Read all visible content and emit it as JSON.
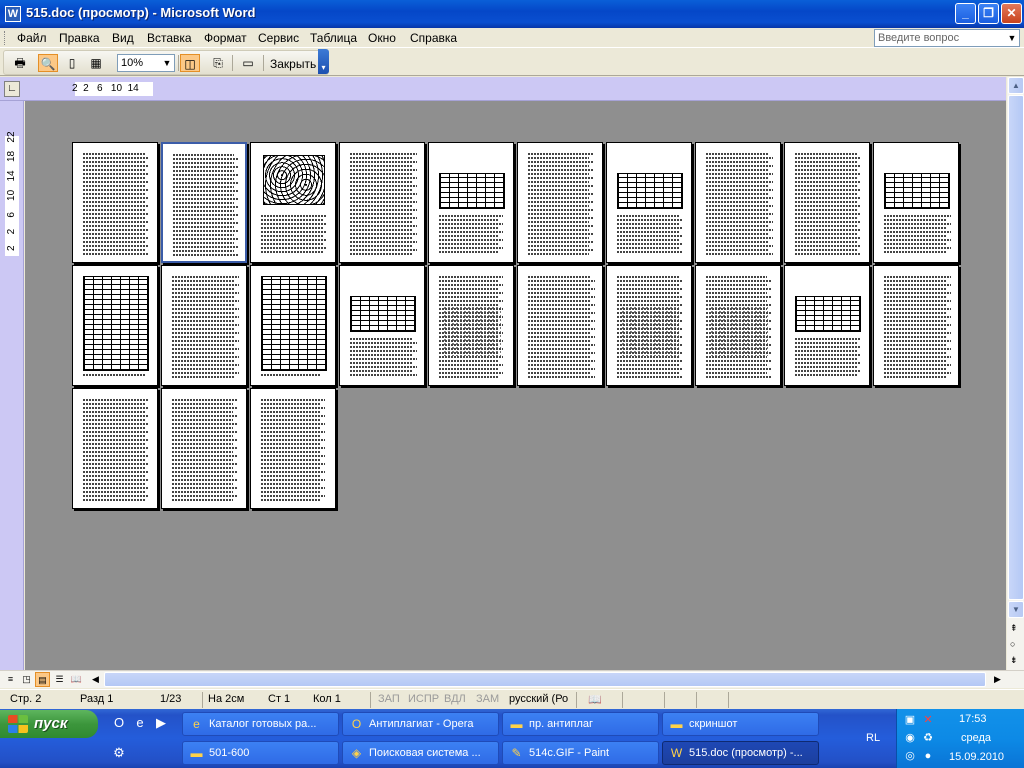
{
  "window": {
    "title": "515.doc (просмотр) - Microsoft Word",
    "icon": "word-doc-icon"
  },
  "menu": {
    "items": [
      "Файл",
      "Правка",
      "Вид",
      "Вставка",
      "Формат",
      "Сервис",
      "Таблица",
      "Окно",
      "Справка"
    ],
    "ask_placeholder": "Введите вопрос"
  },
  "toolbar": {
    "zoom": "10%",
    "close_label": "Закрыть"
  },
  "ruler": {
    "horizontal_marks": "2  2   6   10  14",
    "vertical_marks": "2    2    6    10   14   18   22"
  },
  "preview": {
    "page_count": 23,
    "selected_page": 2
  },
  "statusbar": {
    "page": "Стр. 2",
    "section": "Разд 1",
    "pages": "1/23",
    "at": "На  2см",
    "line": "Ст  1",
    "column": "Кол  1",
    "rec": "ЗАП",
    "trk": "ИСПР",
    "ext": "ВДЛ",
    "ovr": "ЗАМ",
    "language": "русский (Ро"
  },
  "taskbar": {
    "start_label": "пуск",
    "tasks_row1": [
      {
        "label": "Каталог готовых ра...",
        "icon": "ie-icon"
      },
      {
        "label": "Антиплагиат - Opera",
        "icon": "opera-icon"
      },
      {
        "label": "пр. антиплаг",
        "icon": "folder-icon"
      },
      {
        "label": "скриншот",
        "icon": "folder-icon"
      }
    ],
    "tasks_row2": [
      {
        "label": "501-600",
        "icon": "folder-icon"
      },
      {
        "label": "Поисковая система ...",
        "icon": "browser-icon"
      },
      {
        "label": "514c.GIF - Paint",
        "icon": "paint-icon"
      },
      {
        "label": "515.doc (просмотр) -...",
        "icon": "word-icon",
        "active": true
      }
    ],
    "lang": "RL",
    "time": "17:53",
    "day": "среда",
    "date": "15.09.2010"
  }
}
